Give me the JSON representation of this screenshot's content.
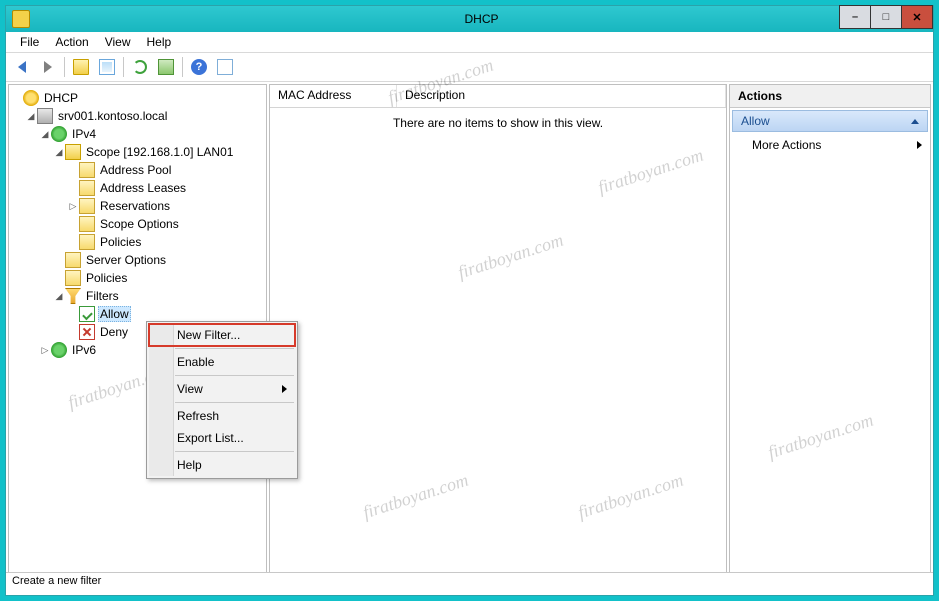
{
  "title": "DHCP",
  "window_buttons": {
    "minimize": "–",
    "maximize": "□",
    "close": "✕"
  },
  "menubar": [
    "File",
    "Action",
    "View",
    "Help"
  ],
  "tree": {
    "root": "DHCP",
    "server": "srv001.kontoso.local",
    "ipv4": "IPv4",
    "scope": "Scope [192.168.1.0] LAN01",
    "address_pool": "Address Pool",
    "address_leases": "Address Leases",
    "reservations": "Reservations",
    "scope_options": "Scope Options",
    "scope_policies": "Policies",
    "server_options": "Server Options",
    "policies": "Policies",
    "filters": "Filters",
    "allow": "Allow",
    "deny": "Deny",
    "ipv6": "IPv6"
  },
  "list": {
    "col_mac": "MAC Address",
    "col_desc": "Description",
    "empty": "There are no items to show in this view."
  },
  "actions": {
    "header": "Actions",
    "title": "Allow",
    "more": "More Actions"
  },
  "context_menu": {
    "new_filter": "New Filter...",
    "enable": "Enable",
    "view": "View",
    "refresh": "Refresh",
    "export_list": "Export List...",
    "help": "Help"
  },
  "statusbar": "Create a new filter",
  "watermark": "firatboyan.com"
}
